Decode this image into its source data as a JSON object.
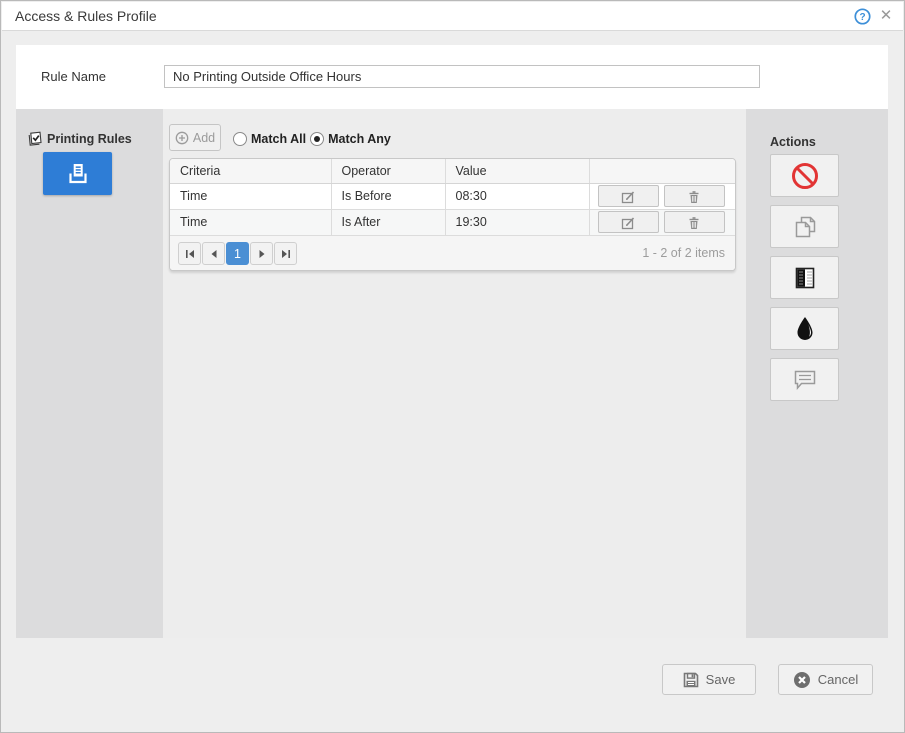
{
  "window": {
    "title": "Access & Rules Profile"
  },
  "rule_name": {
    "label": "Rule Name",
    "value": "No Printing Outside Office Hours"
  },
  "sidebar": {
    "title": "Printing Rules"
  },
  "toolbar": {
    "add_label": "Add",
    "match_all_label": "Match All",
    "match_any_label": "Match Any",
    "selected_match": "Match Any"
  },
  "grid": {
    "columns": [
      "Criteria",
      "Operator",
      "Value",
      ""
    ],
    "rows": [
      {
        "criteria": "Time",
        "operator": "Is Before",
        "value": "08:30"
      },
      {
        "criteria": "Time",
        "operator": "Is After",
        "value": "19:30"
      }
    ],
    "pager": {
      "current_page": "1",
      "summary": "1 - 2 of 2 items"
    }
  },
  "actions": {
    "title": "Actions",
    "items": [
      "deny-printing",
      "copy-pages",
      "grayscale-document",
      "ink-drop",
      "comment"
    ]
  },
  "footer": {
    "save_label": "Save",
    "cancel_label": "Cancel"
  },
  "colors": {
    "accent_blue": "#2e7dd6",
    "pager_blue": "#4b8fd4",
    "deny_red": "#e23434"
  }
}
